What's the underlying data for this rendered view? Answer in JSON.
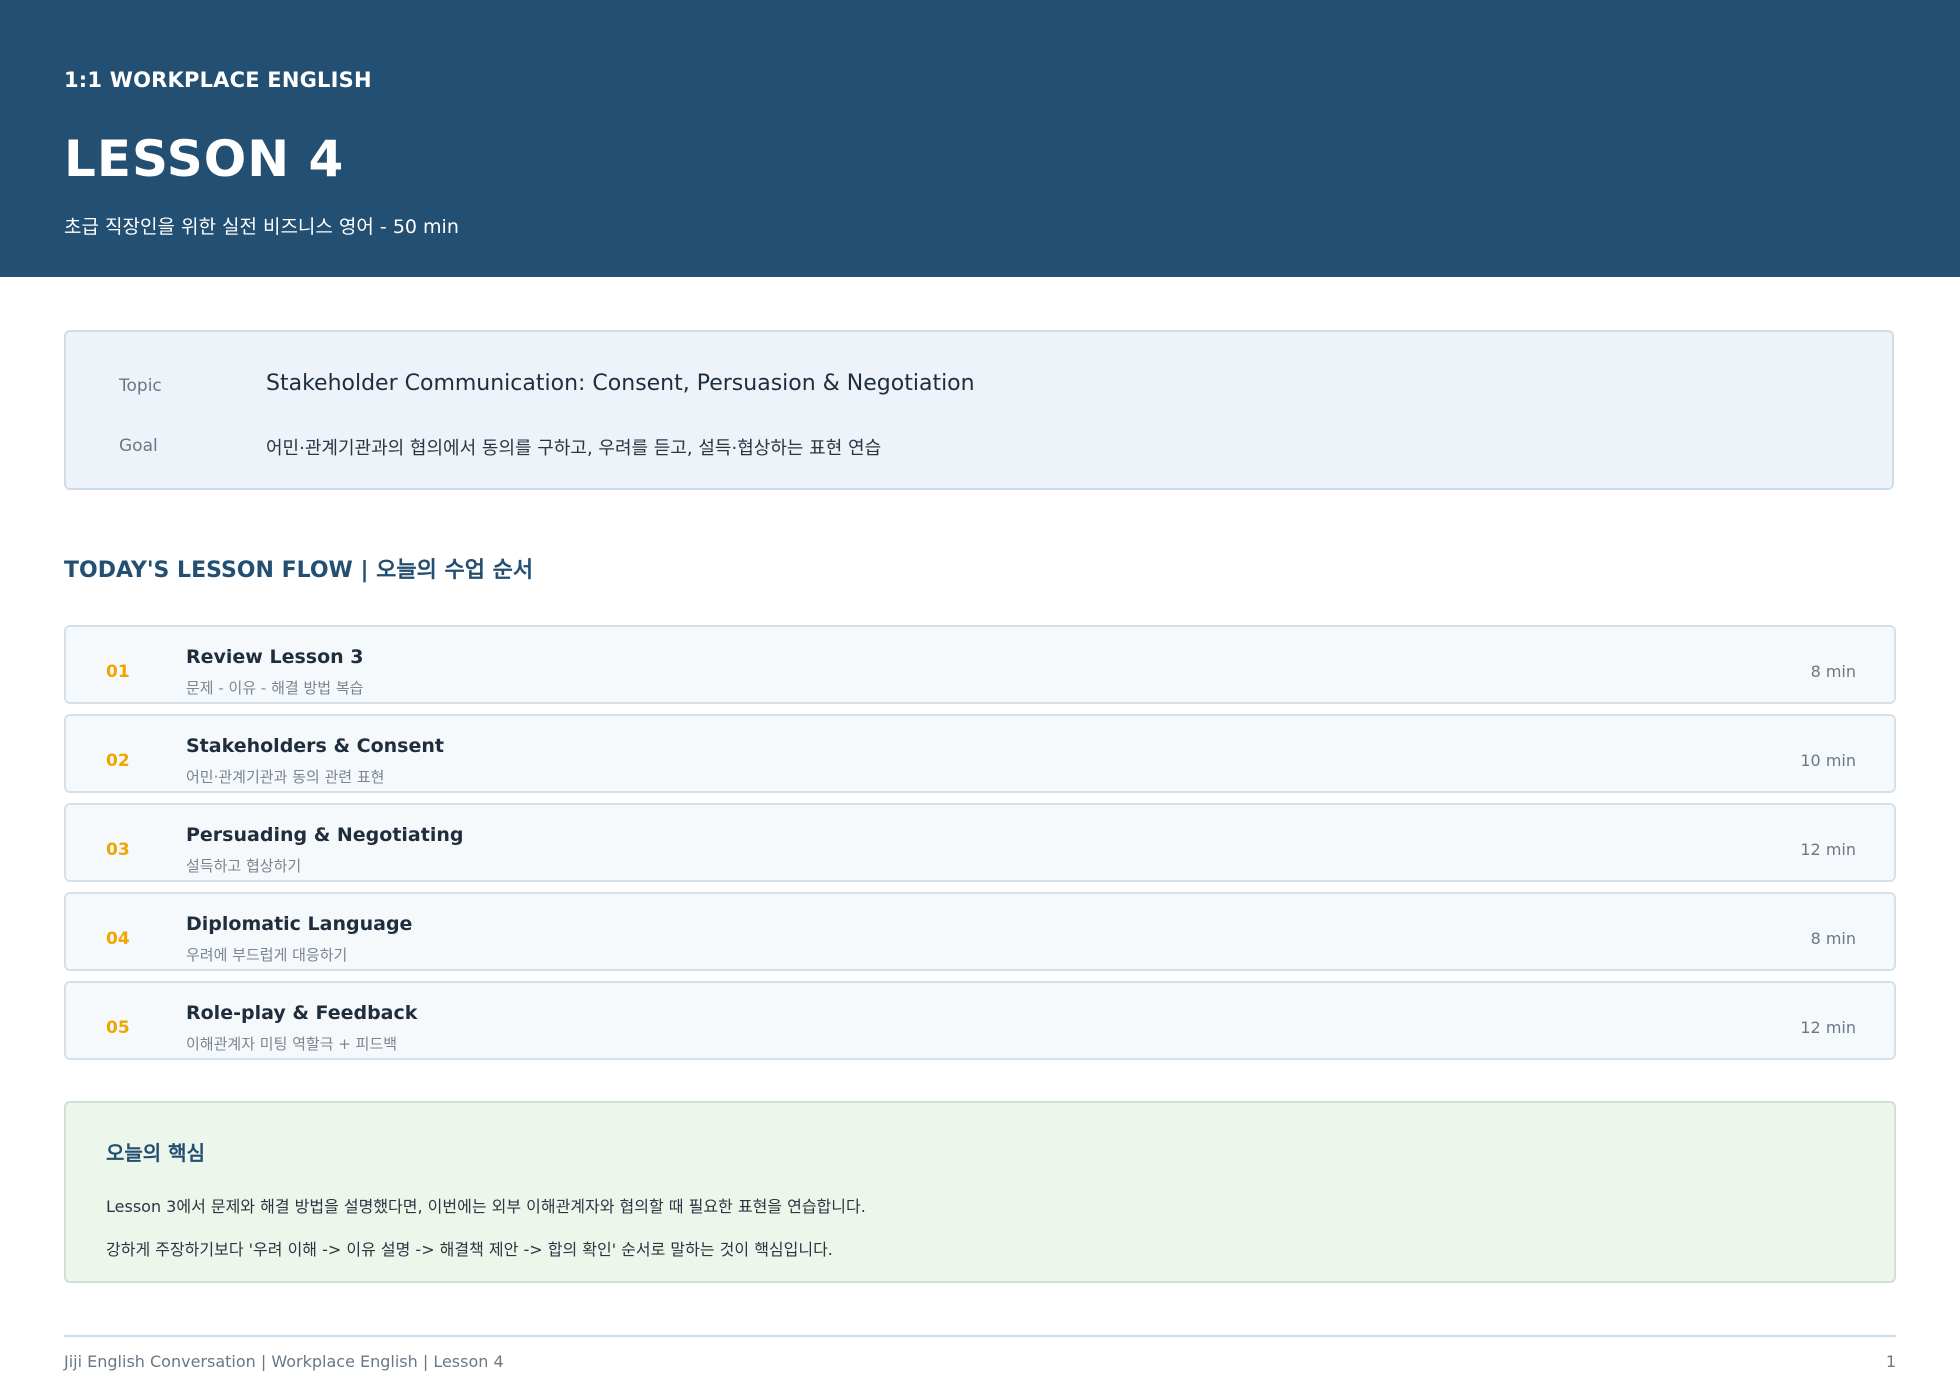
{
  "header": {
    "eyebrow": "1:1 WORKPLACE ENGLISH",
    "title": "LESSON 4",
    "subtitle": "초급 직장인을 위한 실전 비즈니스 영어 - 50 min"
  },
  "info": {
    "topic_label": "Topic",
    "topic_value": "Stakeholder Communication: Consent, Persuasion & Negotiation",
    "goal_label": "Goal",
    "goal_value": "어민·관계기관과의 협의에서 동의를 구하고, 우려를 듣고, 설득·협상하는 표현 연습"
  },
  "flow": {
    "section_title": "TODAY'S LESSON FLOW | 오늘의 수업 순서",
    "items": [
      {
        "num": "01",
        "title": "Review Lesson 3",
        "sub": "문제 - 이유 - 해결 방법 복습",
        "time": "8 min"
      },
      {
        "num": "02",
        "title": "Stakeholders & Consent",
        "sub": "어민·관계기관과 동의 관련 표현",
        "time": "10 min"
      },
      {
        "num": "03",
        "title": "Persuading & Negotiating",
        "sub": "설득하고 협상하기",
        "time": "12 min"
      },
      {
        "num": "04",
        "title": "Diplomatic Language",
        "sub": "우려에 부드럽게 대응하기",
        "time": "8 min"
      },
      {
        "num": "05",
        "title": "Role-play & Feedback",
        "sub": "이해관계자 미팅 역할극 + 피드백",
        "time": "12 min"
      }
    ]
  },
  "key_point": {
    "title": "오늘의 핵심",
    "line1": "Lesson 3에서 문제와 해결 방법을 설명했다면, 이번에는 외부 이해관계자와 협의할 때 필요한 표현을 연습합니다.",
    "line2": "강하게 주장하기보다 '우려 이해 -> 이유 설명 -> 해결책 제안 -> 합의 확인' 순서로 말하는 것이 핵심입니다."
  },
  "footer": {
    "text": "Jiji English Conversation | Workplace English | Lesson 4",
    "page": "1"
  },
  "colors": {
    "header_bg": "#234f72",
    "accent_number": "#f0a500",
    "info_bg": "#edf3f8",
    "key_bg": "#edf6ea"
  }
}
